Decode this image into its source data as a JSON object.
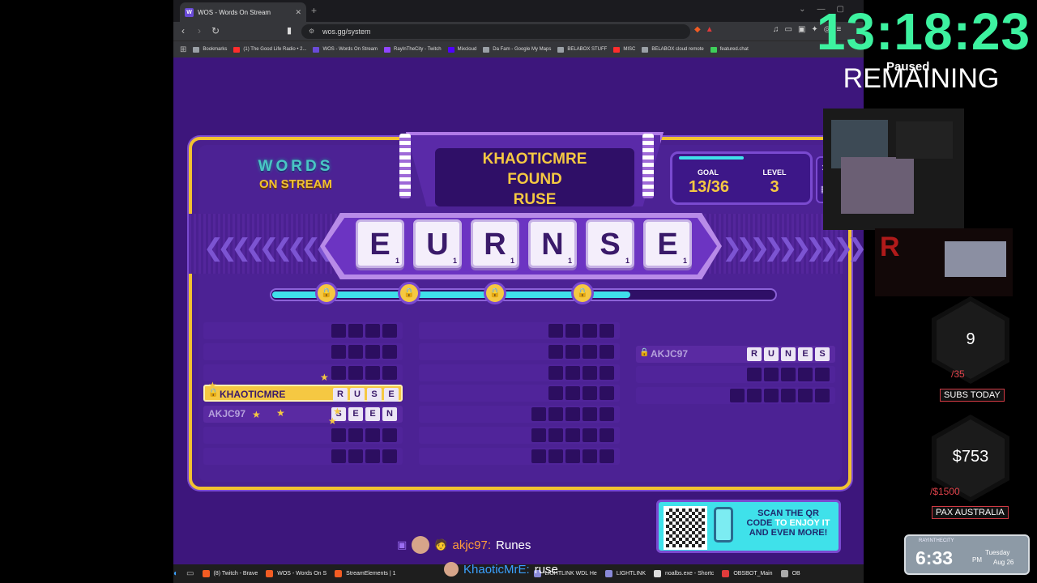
{
  "browser": {
    "tab_title": "WOS - Words On Stream",
    "tab_favicon": "W",
    "url": "wos.gg/system",
    "bookmarks": [
      {
        "label": "Bookmarks",
        "color": "#9aa0a6"
      },
      {
        "label": "(1) The Good Life Radio • 2...",
        "color": "#ff2d2d"
      },
      {
        "label": "WOS - Words On Stream",
        "color": "#6a4bd8"
      },
      {
        "label": "RayInTheCity - Twitch",
        "color": "#9146ff"
      },
      {
        "label": "Mixcloud",
        "color": "#5000ff"
      },
      {
        "label": "Da Fam - Google My Maps",
        "color": "#9aa0a6"
      },
      {
        "label": "BELABOX STUFF",
        "color": "#9aa0a6"
      },
      {
        "label": "MISC",
        "color": "#ff2d2d"
      },
      {
        "label": "BELABOX cloud remote",
        "color": "#9aa0a6"
      },
      {
        "label": "featured.chat",
        "color": "#3ecf5a"
      }
    ]
  },
  "game": {
    "logo_line1": "WORDS",
    "logo_line2": "ON STREAM",
    "banner_line1": "KHAOTICMRE",
    "banner_line2": "FOUND",
    "banner_line3": "RUSE",
    "goal_label": "GOAL",
    "goal_value": "13/36",
    "level_label": "LEVEL",
    "level_value": "3",
    "progress_fraction": 0.71,
    "tiles": [
      {
        "letter": "E",
        "points": "1"
      },
      {
        "letter": "U",
        "points": "1"
      },
      {
        "letter": "R",
        "points": "1"
      },
      {
        "letter": "N",
        "points": "1"
      },
      {
        "letter": "S",
        "points": "1"
      },
      {
        "letter": "E",
        "points": "1"
      }
    ],
    "found_words": [
      {
        "name": "KHAOTICMRE",
        "letters": [
          "R",
          "U",
          "S",
          "E"
        ]
      },
      {
        "name": "AKJC97",
        "letters": [
          "S",
          "E",
          "E",
          "N"
        ]
      },
      {
        "name": "AKJC97",
        "letters": [
          "R",
          "U",
          "N",
          "E",
          "S"
        ]
      }
    ],
    "qr_text_1": "SCAN THE QR",
    "qr_text_2": "CODE",
    "qr_text_3": "TO ENJOY IT",
    "qr_text_4": "AND EVEN MORE!"
  },
  "chat": [
    {
      "user": "akjc97:",
      "message": "Runes"
    },
    {
      "user": "KhaoticMrE:",
      "message": "ruse"
    }
  ],
  "taskbar": [
    {
      "label": "(8) Twitch - Brave",
      "color": "#f25c23"
    },
    {
      "label": "WOS - Words On S",
      "color": "#f25c23"
    },
    {
      "label": "StreamElements | 1",
      "color": "#f25c23"
    },
    {
      "label": "LIGHTLINK WDL He",
      "color": "#8a8ad8"
    },
    {
      "label": "LIGHTLINK",
      "color": "#8a8ad8"
    },
    {
      "label": "noalbs.exe - Shortc",
      "color": "#dddddd"
    },
    {
      "label": "OBSBOT_Main",
      "color": "#e23b3b"
    },
    {
      "label": "OB",
      "color": "#aaaaaa"
    }
  ],
  "overlay": {
    "timer": "13:18:23",
    "paused": "Paused",
    "remaining": "REMAINING",
    "subs_value": "9",
    "subs_goal": "/35",
    "subs_label": "SUBS TODAY",
    "money_value": "$753",
    "money_goal": "/$1500",
    "money_label": "PAX AUSTRALIA",
    "clock_channel": "RAYINTHECITY",
    "clock_time": "6:33",
    "clock_ampm": "PM",
    "clock_day": "Tuesday",
    "clock_date": "Aug 26"
  }
}
